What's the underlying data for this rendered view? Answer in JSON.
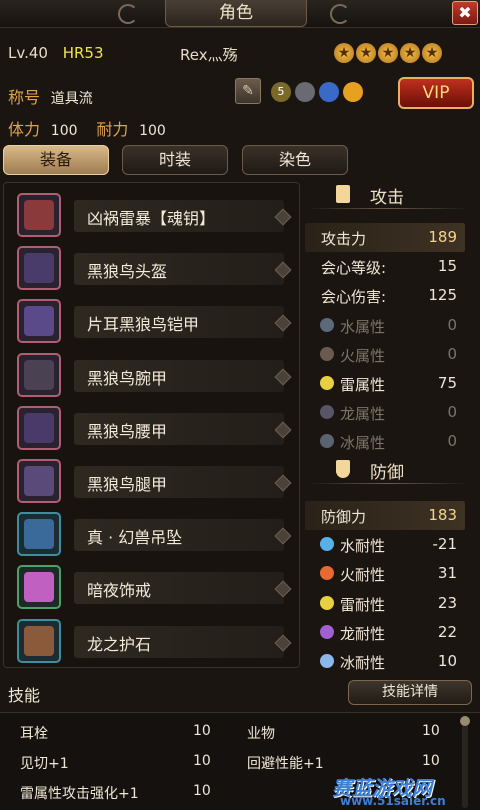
{
  "window": {
    "title": "角色",
    "close_icon": "crossed-tools-icon"
  },
  "player": {
    "level": "Lv.40",
    "hr": "HR53",
    "name": "Rex灬殇",
    "stars": [
      "★",
      "★",
      "★",
      "★",
      "★"
    ],
    "title_label": "称号",
    "title_value": "道具流",
    "stamina_label": "体力",
    "stamina_value": "100",
    "endurance_label": "耐力",
    "endurance_value": "100",
    "vip_label": "VIP"
  },
  "badges": [
    {
      "icon": "gold-5-badge-icon",
      "text": "5",
      "color": "#7a6a2a"
    },
    {
      "icon": "helmet-badge-icon",
      "text": "",
      "color": "#6a6a72"
    },
    {
      "icon": "diamond-badge-icon",
      "text": "",
      "color": "#3a6ac8"
    },
    {
      "icon": "sun-badge-icon",
      "text": "",
      "color": "#e8a020"
    }
  ],
  "tabs": [
    {
      "label": "装备",
      "active": true
    },
    {
      "label": "时装",
      "active": false
    },
    {
      "label": "染色",
      "active": false
    }
  ],
  "equipment": [
    {
      "name": "凶祸雷暴【魂钥】",
      "icon": "weapon-dual-blades-icon",
      "frame": "pink",
      "color": "#8a3a3a"
    },
    {
      "name": "黑狼鸟头盔",
      "icon": "helmet-icon",
      "frame": "pink",
      "color": "#4a3c6a"
    },
    {
      "name": "片耳黑狼鸟铠甲",
      "icon": "chest-armor-icon",
      "frame": "pink",
      "color": "#5a4a8a"
    },
    {
      "name": "黑狼鸟腕甲",
      "icon": "arm-armor-icon",
      "frame": "pink",
      "color": "#4a4252"
    },
    {
      "name": "黑狼鸟腰甲",
      "icon": "waist-armor-icon",
      "frame": "pink",
      "color": "#4a3a6a"
    },
    {
      "name": "黑狼鸟腿甲",
      "icon": "leg-armor-icon",
      "frame": "pink",
      "color": "#5a4a7a"
    },
    {
      "name": "真 · 幻兽吊坠",
      "icon": "pendant-icon",
      "frame": "blue",
      "color": "#3a6a9a"
    },
    {
      "name": "暗夜饰戒",
      "icon": "ring-gem-icon",
      "frame": "green",
      "color": "#c060c0"
    },
    {
      "name": "龙之护石",
      "icon": "amulet-stone-icon",
      "frame": "blue",
      "color": "#8a5a3a"
    }
  ],
  "attack": {
    "title": "攻击",
    "stats": [
      {
        "label": "攻击力",
        "value": "189",
        "icon": "",
        "dim": false
      },
      {
        "label": "会心等级:",
        "value": "15",
        "icon": "",
        "dim": false
      },
      {
        "label": "会心伤害:",
        "value": "125",
        "icon": "",
        "dim": false
      },
      {
        "label": "水属性",
        "value": "0",
        "icon": "water-drop-icon",
        "dim": true,
        "color": "#5a6a78"
      },
      {
        "label": "火属性",
        "value": "0",
        "icon": "fire-icon",
        "dim": true,
        "color": "#6a5a50"
      },
      {
        "label": "雷属性",
        "value": "75",
        "icon": "thunder-icon",
        "dim": false,
        "color": "#e8d040"
      },
      {
        "label": "龙属性",
        "value": "0",
        "icon": "dragon-icon",
        "dim": true,
        "color": "#5a5468"
      },
      {
        "label": "冰属性",
        "value": "0",
        "icon": "ice-icon",
        "dim": true,
        "color": "#5a6470"
      }
    ]
  },
  "defense": {
    "title": "防御",
    "stats": [
      {
        "label": "防御力",
        "value": "183",
        "icon": "",
        "dim": false
      },
      {
        "label": "水耐性",
        "value": "-21",
        "icon": "water-drop-icon",
        "dim": false,
        "color": "#58b0e8"
      },
      {
        "label": "火耐性",
        "value": "31",
        "icon": "fire-icon",
        "dim": false,
        "color": "#e86a30"
      },
      {
        "label": "雷耐性",
        "value": "23",
        "icon": "thunder-icon",
        "dim": false,
        "color": "#e8d040"
      },
      {
        "label": "龙耐性",
        "value": "22",
        "icon": "dragon-icon",
        "dim": false,
        "color": "#a060d0"
      },
      {
        "label": "冰耐性",
        "value": "10",
        "icon": "ice-icon",
        "dim": false,
        "color": "#8ab8e8"
      }
    ]
  },
  "skills": {
    "title": "技能",
    "detail_button": "技能详情",
    "items": [
      {
        "name": "耳栓",
        "value": "10"
      },
      {
        "name": "业物",
        "value": "10"
      },
      {
        "name": "见切+1",
        "value": "10"
      },
      {
        "name": "回避性能+1",
        "value": "10"
      },
      {
        "name": "雷属性攻击强化+1",
        "value": "10"
      }
    ]
  },
  "watermark": {
    "text": "赛蓝游戏网",
    "url": "www.51saier.cn"
  }
}
